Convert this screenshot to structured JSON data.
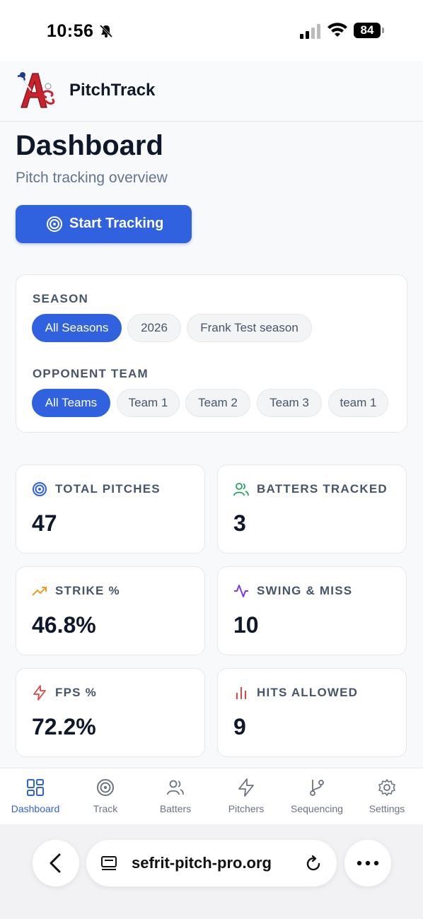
{
  "status_bar": {
    "time": "10:56",
    "battery": "84"
  },
  "header": {
    "app_name": "PitchTrack",
    "logo_icon": "athletics-logo"
  },
  "page": {
    "title": "Dashboard",
    "subtitle": "Pitch tracking overview",
    "start_button": "Start Tracking"
  },
  "filters": {
    "season_label": "SEASON",
    "seasons": [
      "All Seasons",
      "2026",
      "Frank Test season"
    ],
    "selected_season": "All Seasons",
    "opponent_label": "OPPONENT TEAM",
    "teams": [
      "All Teams",
      "Team 1",
      "Team 2",
      "Team 3",
      "team 1"
    ],
    "selected_team": "All Teams"
  },
  "stats": [
    {
      "label": "TOTAL PITCHES",
      "value": "47",
      "icon": "target-icon",
      "color": "#3062e0"
    },
    {
      "label": "BATTERS TRACKED",
      "value": "3",
      "icon": "users-icon",
      "color": "#22a55a"
    },
    {
      "label": "STRIKE %",
      "value": "46.8%",
      "icon": "trending-up-icon",
      "color": "#e8a025"
    },
    {
      "label": "SWING & MISS",
      "value": "10",
      "icon": "activity-icon",
      "color": "#7c3aed"
    },
    {
      "label": "FPS %",
      "value": "72.2%",
      "icon": "zap-icon",
      "color": "#e04545"
    },
    {
      "label": "HITS ALLOWED",
      "value": "9",
      "icon": "bar-chart-icon",
      "color": "#e04545"
    }
  ],
  "nav": {
    "items": [
      "Dashboard",
      "Track",
      "Batters",
      "Pitchers",
      "Sequencing",
      "Settings"
    ],
    "active": "Dashboard"
  },
  "browser": {
    "url": "sefrit-pitch-pro.org"
  },
  "colors": {
    "accent": "#3062e0",
    "muted": "#64748b"
  }
}
